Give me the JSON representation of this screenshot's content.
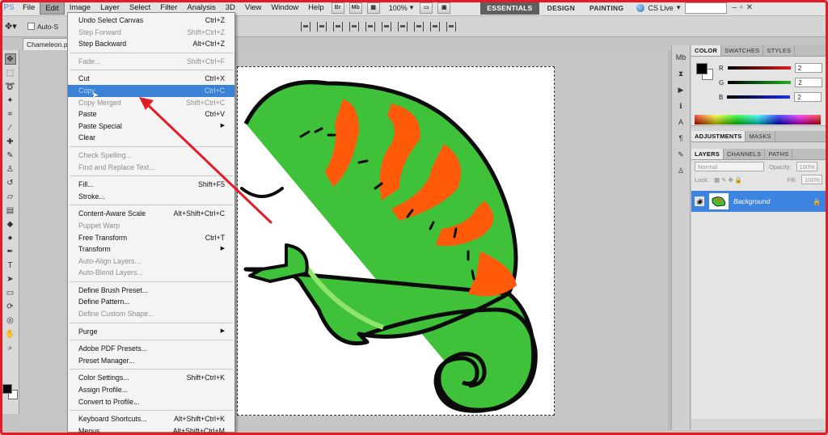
{
  "app": {
    "logo": "PS"
  },
  "menubar": {
    "items": [
      "File",
      "Edit",
      "Image",
      "Layer",
      "Select",
      "Filter",
      "Analysis",
      "3D",
      "View",
      "Window",
      "Help"
    ],
    "active_item": "Edit",
    "bridge_label": "Br",
    "minibridge_label": "Mb",
    "zoom": "100%",
    "workspaces": [
      "ESSENTIALS",
      "DESIGN",
      "PAINTING"
    ],
    "cs_live": "CS Live"
  },
  "options_bar": {
    "auto_select_label": "Auto-S"
  },
  "document": {
    "tab_title": "Chameleon.p"
  },
  "edit_menu": {
    "groups": [
      [
        {
          "label": "Undo Select Canvas",
          "shortcut": "Ctrl+Z",
          "disabled": false
        },
        {
          "label": "Step Forward",
          "shortcut": "Shift+Ctrl+Z",
          "disabled": true
        },
        {
          "label": "Step Backward",
          "shortcut": "Alt+Ctrl+Z",
          "disabled": false
        }
      ],
      [
        {
          "label": "Fade...",
          "shortcut": "Shift+Ctrl+F",
          "disabled": true
        }
      ],
      [
        {
          "label": "Cut",
          "shortcut": "Ctrl+X",
          "disabled": false
        },
        {
          "label": "Copy",
          "shortcut": "Ctrl+C",
          "disabled": false,
          "highlight": true
        },
        {
          "label": "Copy Merged",
          "shortcut": "Shift+Ctrl+C",
          "disabled": true
        },
        {
          "label": "Paste",
          "shortcut": "Ctrl+V",
          "disabled": false
        },
        {
          "label": "Paste Special",
          "shortcut": "",
          "disabled": false,
          "submenu": true
        },
        {
          "label": "Clear",
          "shortcut": "",
          "disabled": false
        }
      ],
      [
        {
          "label": "Check Spelling...",
          "shortcut": "",
          "disabled": true
        },
        {
          "label": "Find and Replace Text...",
          "shortcut": "",
          "disabled": true
        }
      ],
      [
        {
          "label": "Fill...",
          "shortcut": "Shift+F5",
          "disabled": false
        },
        {
          "label": "Stroke...",
          "shortcut": "",
          "disabled": false
        }
      ],
      [
        {
          "label": "Content-Aware Scale",
          "shortcut": "Alt+Shift+Ctrl+C",
          "disabled": false
        },
        {
          "label": "Puppet Warp",
          "shortcut": "",
          "disabled": true
        },
        {
          "label": "Free Transform",
          "shortcut": "Ctrl+T",
          "disabled": false
        },
        {
          "label": "Transform",
          "shortcut": "",
          "disabled": false,
          "submenu": true
        },
        {
          "label": "Auto-Align Layers...",
          "shortcut": "",
          "disabled": true
        },
        {
          "label": "Auto-Blend Layers...",
          "shortcut": "",
          "disabled": true
        }
      ],
      [
        {
          "label": "Define Brush Preset...",
          "shortcut": "",
          "disabled": false
        },
        {
          "label": "Define Pattern...",
          "shortcut": "",
          "disabled": false
        },
        {
          "label": "Define Custom Shape...",
          "shortcut": "",
          "disabled": true
        }
      ],
      [
        {
          "label": "Purge",
          "shortcut": "",
          "disabled": false,
          "submenu": true
        }
      ],
      [
        {
          "label": "Adobe PDF Presets...",
          "shortcut": "",
          "disabled": false
        },
        {
          "label": "Preset Manager...",
          "shortcut": "",
          "disabled": false
        }
      ],
      [
        {
          "label": "Color Settings...",
          "shortcut": "Shift+Ctrl+K",
          "disabled": false
        },
        {
          "label": "Assign Profile...",
          "shortcut": "",
          "disabled": false
        },
        {
          "label": "Convert to Profile...",
          "shortcut": "",
          "disabled": false
        }
      ],
      [
        {
          "label": "Keyboard Shortcuts...",
          "shortcut": "Alt+Shift+Ctrl+K",
          "disabled": false
        },
        {
          "label": "Menus...",
          "shortcut": "Alt+Shift+Ctrl+M",
          "disabled": false
        }
      ]
    ]
  },
  "color_panel": {
    "tabs": [
      "COLOR",
      "SWATCHES",
      "STYLES"
    ],
    "channels": [
      {
        "label": "R",
        "value": "2",
        "color": "#e02020"
      },
      {
        "label": "G",
        "value": "2",
        "color": "#20b020"
      },
      {
        "label": "B",
        "value": "2",
        "color": "#2030e0"
      }
    ]
  },
  "adjustments_panel": {
    "tabs": [
      "ADJUSTMENTS",
      "MASKS"
    ]
  },
  "layers_panel": {
    "tabs": [
      "LAYERS",
      "CHANNELS",
      "PATHS"
    ],
    "blend_mode": "Normal",
    "opacity_label": "Opacity:",
    "opacity": "100%",
    "lock_label": "Lock:",
    "fill_label": "Fill:",
    "fill": "100%",
    "layer_name": "Background"
  },
  "colors": {
    "menu_highlight": "#3b82d6",
    "annotation": "#e21c24",
    "chameleon_green": "#3fc23a",
    "chameleon_orange": "#ff5a0a"
  }
}
